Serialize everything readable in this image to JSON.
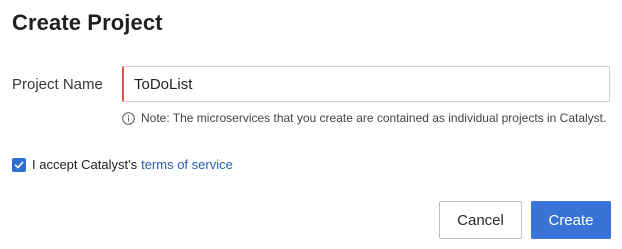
{
  "dialog": {
    "title": "Create Project",
    "project_name_label": "Project Name",
    "project_name_value": "ToDoList",
    "note_text": "Note: The microservices that you create are contained as individual projects in Catalyst.",
    "accept_text": "I accept Catalyst's",
    "terms_link": "terms of service",
    "accept_checked": true,
    "cancel_label": "Cancel",
    "create_label": "Create"
  },
  "colors": {
    "accent": "#3a73d6",
    "link": "#2a5db0",
    "input_focus_border": "#d9534f"
  },
  "icons": {
    "note_icon": "info-icon",
    "checkbox_icon": "checkmark-icon"
  }
}
